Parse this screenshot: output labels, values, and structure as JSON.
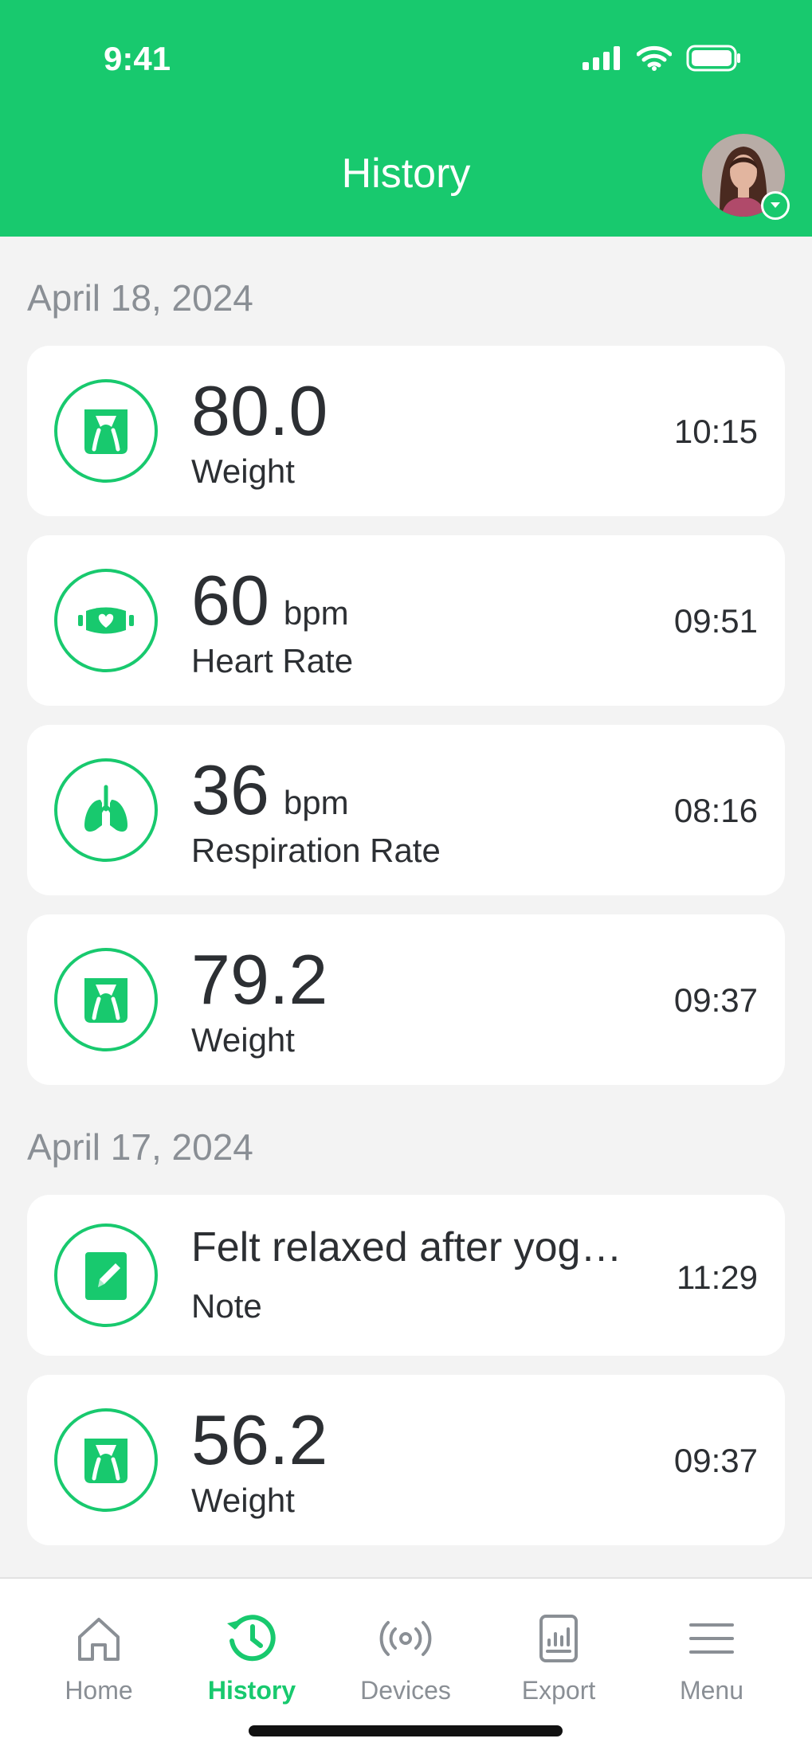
{
  "status": {
    "time": "9:41"
  },
  "header": {
    "title": "History"
  },
  "sections": [
    {
      "date": "April 18, 2024"
    },
    {
      "date": "April 17, 2024"
    }
  ],
  "entries": [
    {
      "value": "80.0",
      "unit": "",
      "label": "Weight",
      "time": "10:15",
      "icon": "scale-icon"
    },
    {
      "value": "60",
      "unit": "bpm",
      "label": "Heart Rate",
      "time": "09:51",
      "icon": "heart-rate-icon"
    },
    {
      "value": "36",
      "unit": "bpm",
      "label": "Respiration Rate",
      "time": "08:16",
      "icon": "lungs-icon"
    },
    {
      "value": "79.2",
      "unit": "",
      "label": "Weight",
      "time": "09:37",
      "icon": "scale-icon"
    },
    {
      "value": "Felt relaxed after yog…",
      "unit": "",
      "label": "Note",
      "time": "11:29",
      "icon": "note-icon"
    },
    {
      "value": "56.2",
      "unit": "",
      "label": "Weight",
      "time": "09:37",
      "icon": "scale-icon"
    }
  ],
  "tabs": [
    {
      "label": "Home",
      "icon": "home-icon"
    },
    {
      "label": "History",
      "icon": "history-icon"
    },
    {
      "label": "Devices",
      "icon": "devices-icon"
    },
    {
      "label": "Export",
      "icon": "export-icon"
    },
    {
      "label": "Menu",
      "icon": "menu-icon"
    }
  ],
  "colors": {
    "accent": "#18c96e",
    "text": "#2c2f33",
    "muted": "#8a8f95",
    "background": "#f3f3f3"
  }
}
